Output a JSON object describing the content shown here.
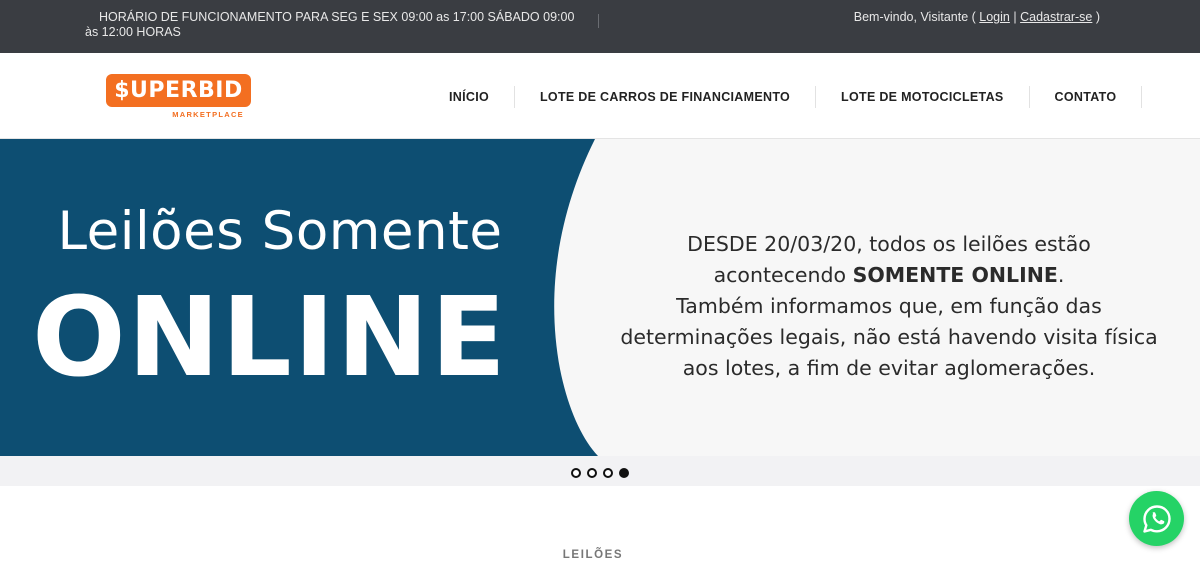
{
  "topbar": {
    "hours": "HORÁRIO DE FUNCIONAMENTO PARA SEG E SEX 09:00 as 17:00 SÁBADO 09:00 às 12:00 HORAS",
    "welcome_prefix": "Bem-vindo, Visitante (",
    "login": "Login",
    "pipe": "|",
    "register": "Cadastrar-se",
    "welcome_suffix": ")"
  },
  "logo": {
    "brand": "$UPERBID",
    "subtitle": "MARKETPLACE",
    "color": "#f36f21"
  },
  "nav": {
    "items": [
      "INÍCIO",
      "LOTE DE CARROS DE FINANCIAMENTO",
      "LOTE DE MOTOCICLETAS",
      "CONTATO"
    ]
  },
  "banner": {
    "headline_line1": "Leilões Somente",
    "headline_line2": "ONLINE",
    "notice_line1": "DESDE 20/03/20, todos os leilões estão",
    "notice_line2_pre": "acontecendo ",
    "notice_line2_bold": "SOMENTE ONLINE",
    "notice_line2_post": ".",
    "notice_line3": "Também informamos que, em função das",
    "notice_line4": "determinações legais, não está havendo visita física",
    "notice_line5": "aos lotes, a fim de evitar aglomerações.",
    "panel_color": "#0d4e72"
  },
  "carousel": {
    "slide_count": 4,
    "active_index": 3
  },
  "section": {
    "label": "LEILÕES"
  },
  "whatsapp": {
    "icon": "whatsapp-icon",
    "color": "#25d366"
  }
}
